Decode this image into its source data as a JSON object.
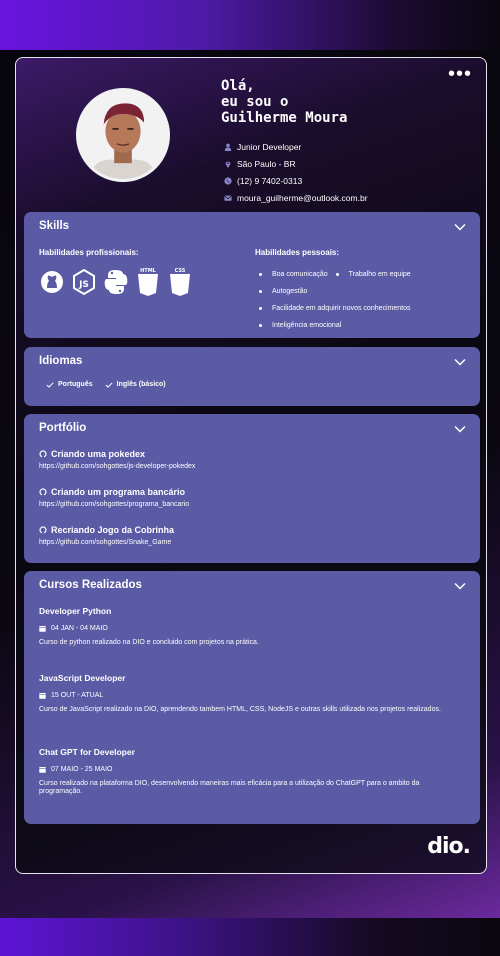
{
  "header": {
    "greeting_line1": "Olá,",
    "greeting_line2": "eu sou o",
    "name": "Guilherme Moura",
    "info": [
      {
        "icon": "person-icon",
        "text": "Junior Developer"
      },
      {
        "icon": "location-icon",
        "text": "São Paulo - BR"
      },
      {
        "icon": "phone-icon",
        "text": "(12) 9 7402-0313"
      },
      {
        "icon": "email-icon",
        "text": "moura_guilherme@outlook.com.br"
      }
    ]
  },
  "skills": {
    "title": "Skills",
    "professional_title": "Habilidades profissionais:",
    "personal_title": "Habilidades pessoais:",
    "tech_icons": [
      "github-icon",
      "nodejs-icon",
      "python-icon",
      "html5-icon",
      "css3-icon"
    ],
    "html_label": "HTML",
    "css_label": "CSS",
    "personal": [
      "Boa comunicação",
      "Trabalho em equipe",
      "Autogestão",
      "Facilidade em adquirir novos conhecimentos",
      "Inteligência emocional"
    ]
  },
  "languages": {
    "title": "Idiomas",
    "items": [
      "Português",
      "Inglês (básico)"
    ]
  },
  "portfolio": {
    "title": "Portfólio",
    "projects": [
      {
        "name": "Criando uma pokedex",
        "link": "https://github.com/sohgottes/js-developer-pokedex"
      },
      {
        "name": "Criando um programa bancário",
        "link": "https://github.com/sohgottes/programa_bancario"
      },
      {
        "name": "Recriando Jogo da Cobrinha",
        "link": "https://github.com/sohgottes/Snake_Game"
      }
    ]
  },
  "courses": {
    "title": "Cursos Realizados",
    "items": [
      {
        "name": "Developer Python",
        "date": "04 JAN - 04 MAIO",
        "desc": "Curso de python realizado na DIO e concluido com projetos na prática."
      },
      {
        "name": "JavaScript Developer",
        "date": "15 OUT - ATUAL",
        "desc": "Curso de JavaScript realizado na DIO, aprendendo tambem HTML, CSS, NodeJS e outras skills utilizada nos projetos realizados."
      },
      {
        "name": "Chat GPT for Developer",
        "date": "07 MAIO - 25 MAIO",
        "desc": "Curso realizado na plataforma DIO, desenvolvendo maneiras mais eficácia para a utilização do ChatGPT para o ambito da programação."
      }
    ]
  },
  "brand": {
    "logo_text": "dio.",
    "accent_panel": "#5a5aa5",
    "accent_purple": "#6a13e0"
  }
}
